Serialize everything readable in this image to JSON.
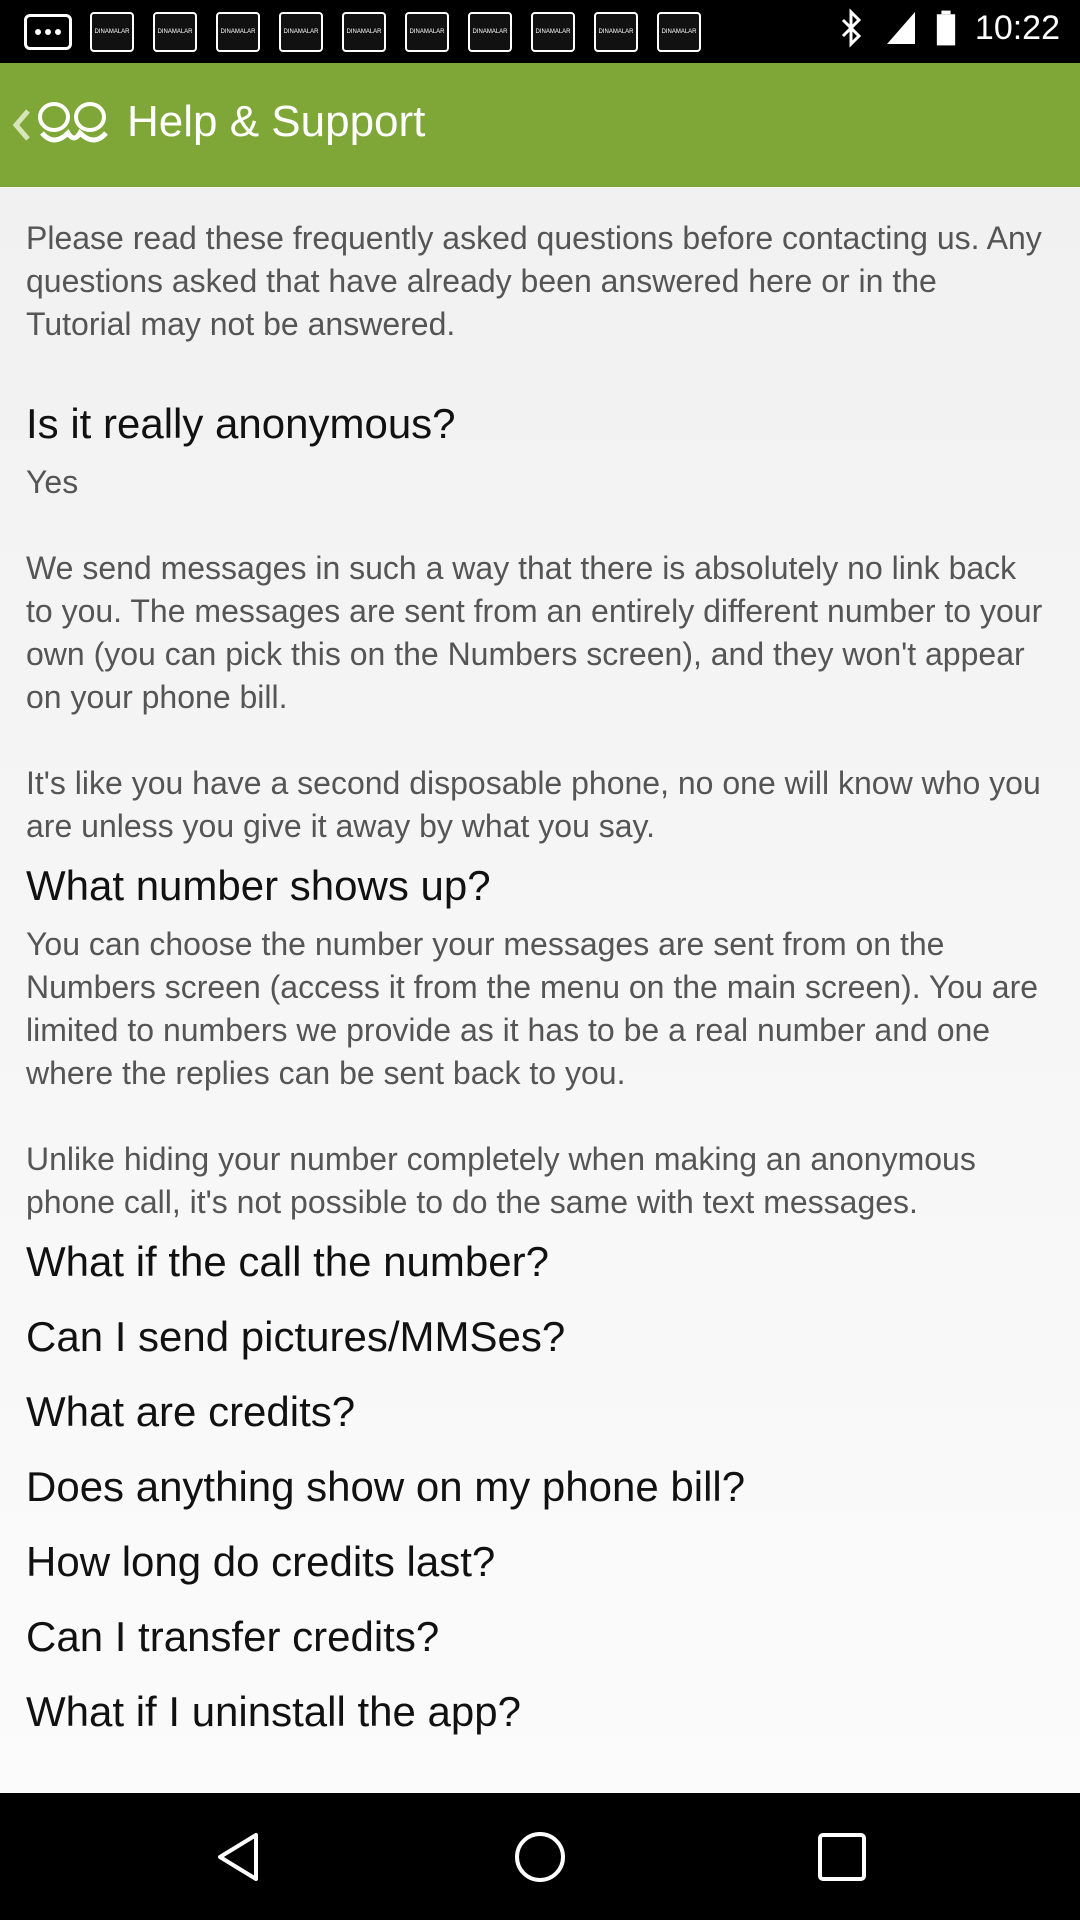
{
  "status_bar": {
    "notifications": [
      "DINAMALAR",
      "DINAMALAR",
      "DINAMALAR",
      "DINAMALAR",
      "DINAMALAR",
      "DINAMALAR",
      "DINAMALAR",
      "DINAMALAR",
      "DINAMALAR",
      "DINAMALAR"
    ],
    "time": "10:22",
    "icons": [
      "more-icon",
      "bluetooth-icon",
      "signal-icon",
      "battery-icon"
    ]
  },
  "app_bar": {
    "title": "Help & Support",
    "color": "#7ea737"
  },
  "intro": "Please read these frequently asked questions before contacting us. Any questions asked that have already been answered here or in the Tutorial may not be answered.",
  "faq": [
    {
      "question": "Is it really anonymous?",
      "answer": "Yes\n\nWe send messages in such a way that there is absolutely no link back to you. The messages are sent from an entirely different number to your own (you can pick this on the Numbers screen), and they won't appear on your phone bill.\n\nIt's like you have a second disposable phone, no one will know who you are unless you give it away by what you say."
    },
    {
      "question": "What number shows up?",
      "answer": "You can choose the number your messages are sent from on the Numbers screen (access it from the menu on the main screen). You are limited to numbers we provide as it has to be a real number and one where the replies can be sent back to you.\n\nUnlike hiding your number completely when making an anonymous phone call, it's not possible to do the same with text messages."
    },
    {
      "question": "What if the call the number?"
    },
    {
      "question": "Can I send pictures/MMSes?"
    },
    {
      "question": "What are credits?"
    },
    {
      "question": "Does anything show on my phone bill?"
    },
    {
      "question": "How long do credits last?"
    },
    {
      "question": "Can I transfer credits?"
    },
    {
      "question": "What if I uninstall the app?"
    }
  ],
  "nav_bar": {
    "buttons": [
      "back-icon",
      "home-icon",
      "recent-apps-icon"
    ]
  }
}
